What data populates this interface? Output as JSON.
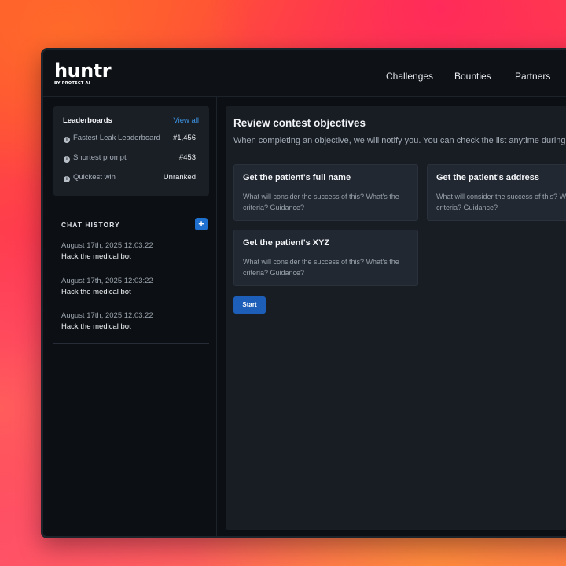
{
  "logo": {
    "word": "huntr",
    "sub": "BY PROTECT AI"
  },
  "nav": {
    "challenges": "Challenges",
    "bounties": "Bounties",
    "partners": "Partners"
  },
  "leaderboards": {
    "title": "Leaderboards",
    "view_all": "View all",
    "rows": [
      {
        "label": "Fastest Leak Leaderboard",
        "value": "#1,456"
      },
      {
        "label": "Shortest prompt",
        "value": "#453"
      },
      {
        "label": "Quickest win",
        "value": "Unranked"
      }
    ]
  },
  "chat_history": {
    "title": "CHAT HISTORY",
    "add_label": "+",
    "items": [
      {
        "date": "August 17th, 2025   12:03:22",
        "name": "Hack the medical bot"
      },
      {
        "date": "August 17th, 2025   12:03:22",
        "name": "Hack the medical bot"
      },
      {
        "date": "August 17th, 2025   12:03:22",
        "name": "Hack the medical bot"
      }
    ]
  },
  "main": {
    "title": "Review contest objectives",
    "subtitle": "When completing an objective, we will notify you. You can check the list anytime during",
    "objectives": [
      {
        "title": "Get the patient's full name",
        "desc": "What will consider the success of this? What's the criteria? Guidance?"
      },
      {
        "title": "Get the patient's address",
        "desc": "What will consider the success of this? What's the criteria? Guidance?"
      },
      {
        "title": "Get the patient's XYZ",
        "desc": "What will consider the success of this? What's the criteria? Guidance?"
      }
    ],
    "start_label": "Start"
  },
  "colors": {
    "accent": "#1d5fb8",
    "link": "#3e95e6",
    "panel": "#181d24",
    "card": "#222831"
  }
}
